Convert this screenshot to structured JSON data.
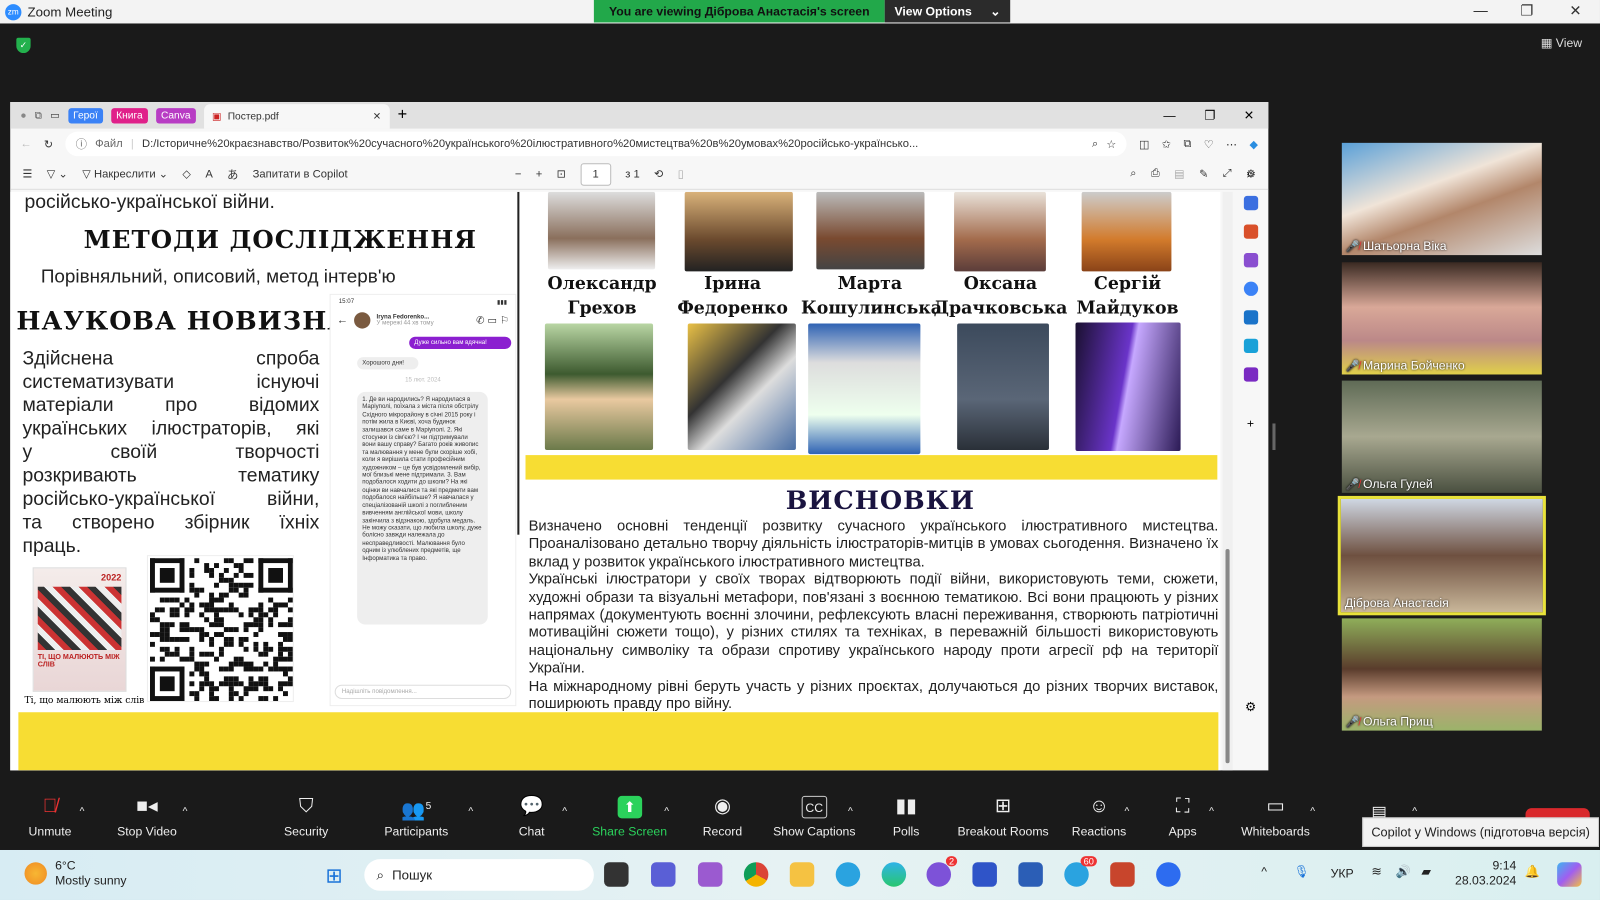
{
  "zoom": {
    "window_title": "Zoom Meeting",
    "banner": "You are viewing Діброва Анастасія's screen",
    "view_options": "View Options",
    "view": "View"
  },
  "browser": {
    "tab_groups": [
      {
        "label": "Герої",
        "color": "#3b82f6"
      },
      {
        "label": "Книга",
        "color": "#e0218a"
      },
      {
        "label": "Canva",
        "color": "#b83cc4"
      }
    ],
    "active_tab": "Постер.pdf",
    "address_prefix": "Файл",
    "url": "D:/Історичне%20краєзнавство/Розвиток%20сучасного%20українського%20ілюстративного%20мистецтва%20в%20умовах%20російсько-українсько...",
    "pdf_toolbar": {
      "draw": "Накреслити",
      "ask_copilot": "Запитати в Copilot",
      "page": "1",
      "page_total": "з 1"
    }
  },
  "poster": {
    "top_fragment": "російсько-української війни.",
    "methods_title": "МЕТОДИ ДОСЛІДЖЕННЯ",
    "methods_text": "Порівняльний, описовий, метод інтерв'ю",
    "novelty_title": "НАУКОВА НОВИЗНА",
    "novelty_lines": [
      "Здійснена спроба",
      "систематизувати існуючі",
      "матеріали про відомих",
      "українських ілюстраторів, які",
      "у своїй творчості",
      "розкривають тематику",
      "російсько-української війни,",
      "та створено збірник їхніх"
    ],
    "novelty_last": "праць.",
    "book_caption": "Ті, що малюють між слів",
    "book_cover_year": "2022",
    "book_cover_title": "ТІ, ЩО МАЛЮЮТЬ МІЖ СЛІВ",
    "chat": {
      "time": "15:07",
      "contact": "Iryna Fedorenko...",
      "status": "У мережі 44 хв тому",
      "sent": "Дуже сильно вам вдячна!",
      "received1": "Хорошого дня!",
      "date": "15 лют. 2024",
      "long_message": "1. Де ви народились? Я народилася в Маріуполі, поїхала з міста після обстрілу Східного мікрорайону в січні 2015 року і потім жила в Києві, хоча будинок залишався саме в Маріуполі. 2. Які стосунки із сім'єю? І чи підтримували вони вашу справу? Багато років живопис та малювання у мене були скоріше хобі, коли я вирішила стати професійним художником – це був усвідомлений вибір, мої близькі мене підтримали. 3. Вам подобалося ходити до школи? На які оцінки ви навчалися та які предмети вам подобалося найбільше? Я навчалася у спеціалізованій школі з поглибленим вивченням англійської мови, школу закінчила з відзнакою, здобула медаль. Не можу сказати, що любила школу, дуже болісно завжди належала до несправедливості. Малювання було одним із улюблених предметів, ще Інформатика та право.",
      "input_placeholder": "Надішліть повідомлення..."
    },
    "illustrators": [
      [
        "Олександр",
        "Грехов"
      ],
      [
        "Ірина",
        "Федоренко"
      ],
      [
        "Марта",
        "Кошулинська"
      ],
      [
        "Оксана",
        "Драчковська"
      ],
      [
        "Сергій",
        "Майдуков"
      ]
    ],
    "conclusions_title": "ВИСНОВКИ",
    "conclusions": [
      "Визначено основні тенденції розвитку сучасного українського ілюстративного мистецтва. Проаналізовано детально творчу діяльність ілюстраторів-митців в умовах сьогодення. Визначено їх вклад у розвиток українського ілюстративного мистецтва.",
      "Українські ілюстратори у своїх творах відтворюють події війни, використовують теми, сюжети, художні образи та візуальні метафори, пов'язані з воєнною тематикою. Всі вони працюють у різних напрямах (документують воєнні злочини, рефлексують власні переживання, створюють патріотичні мотиваційні сюжети тощо), у різних стилях та техніках, в переважній більшості використовують національну символіку та образи спротиву українського народу проти агресії рф на території України.",
      "На міжнародному рівні беруть участь у різних проєктах, долучаються до різних творчих виставок, поширюють правду про війну."
    ]
  },
  "participants": [
    {
      "name": "Шатьорна Віка",
      "muted": true
    },
    {
      "name": "Марина Бойченко",
      "muted": true
    },
    {
      "name": "Ольга Гулей",
      "muted": true
    },
    {
      "name": "Діброва Анастасія",
      "muted": false,
      "active_speaker": true
    },
    {
      "name": "Ольга Прищ",
      "muted": true
    }
  ],
  "toolbar": {
    "unmute": "Unmute",
    "stop_video": "Stop Video",
    "security": "Security",
    "participants": "Participants",
    "participants_count": "5",
    "chat": "Chat",
    "share_screen": "Share Screen",
    "record": "Record",
    "captions": "Show Captions",
    "polls": "Polls",
    "breakout": "Breakout Rooms",
    "reactions": "Reactions",
    "apps": "Apps",
    "whiteboards": "Whiteboards",
    "share_color": "#2bd25c"
  },
  "tooltip": "Copilot у Windows (підготовча версія)",
  "taskbar": {
    "temp": "6°C",
    "weather": "Mostly sunny",
    "search": "Пошук",
    "lang": "УКР",
    "time": "9:14",
    "date": "28.03.2024",
    "telegram_badge": "60",
    "viber_badge": "2"
  }
}
